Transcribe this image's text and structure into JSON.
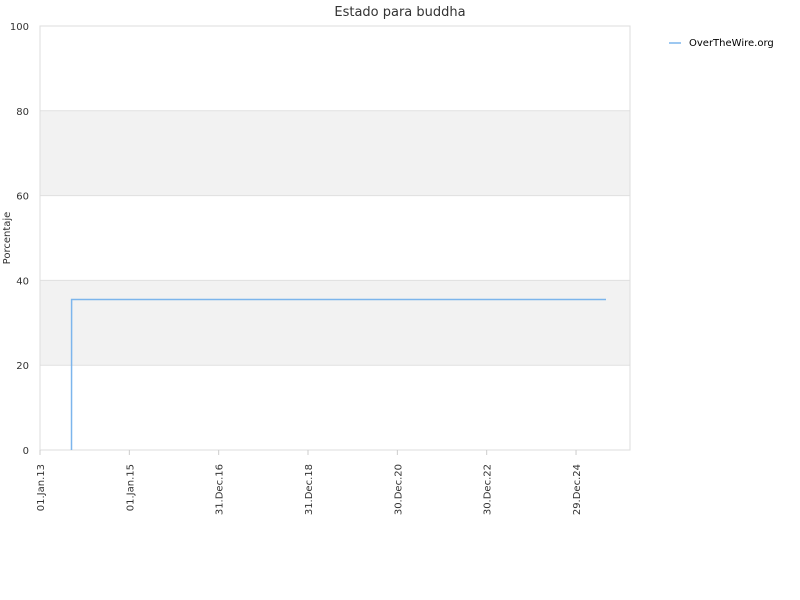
{
  "chart_data": {
    "type": "line",
    "title": "Estado para buddha",
    "ylabel": "Porcentaje",
    "xlabel": "",
    "ylim": [
      0,
      100
    ],
    "yticks": [
      0,
      20,
      40,
      60,
      80,
      100
    ],
    "xlim": [
      "2013-01-01",
      "2026-03-15"
    ],
    "xticks": [
      {
        "date": "2013-01-01",
        "label": "01.Jan.13"
      },
      {
        "date": "2015-01-01",
        "label": "01.Jan.15"
      },
      {
        "date": "2016-12-31",
        "label": "31.Dec.16"
      },
      {
        "date": "2018-12-31",
        "label": "31.Dec.18"
      },
      {
        "date": "2020-12-30",
        "label": "30.Dec.20"
      },
      {
        "date": "2022-12-30",
        "label": "30.Dec.22"
      },
      {
        "date": "2024-12-29",
        "label": "29.Dec.24"
      }
    ],
    "grid": true,
    "alternating_bands": true,
    "legend_position": "top-right",
    "series": [
      {
        "name": "OverTheWire.org",
        "color": "#7cb5ec",
        "points": [
          {
            "x": "2013-09-15",
            "y": 0
          },
          {
            "x": "2013-09-16",
            "y": 35.5
          },
          {
            "x": "2025-08-31",
            "y": 35.5
          }
        ]
      }
    ]
  }
}
